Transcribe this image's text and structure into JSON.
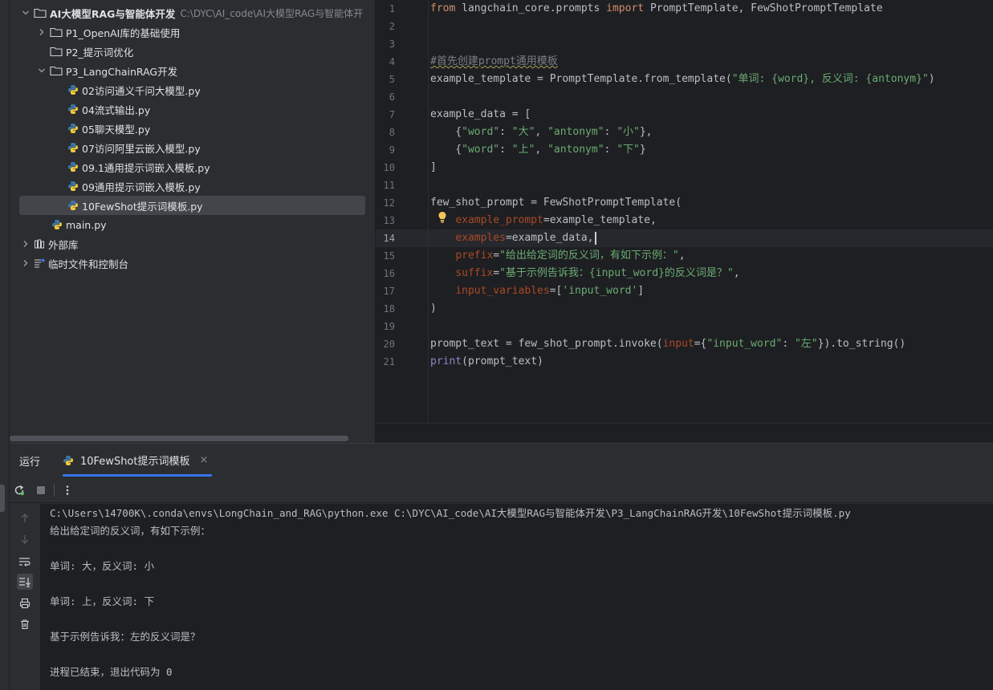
{
  "project": {
    "root_name": "AI大模型RAG与智能体开发",
    "root_path": "C:\\DYC\\AI_code\\AI大模型RAG与智能体开",
    "items": [
      {
        "label": "P1_OpenAI库的基础使用",
        "type": "folder"
      },
      {
        "label": "P2_提示词优化",
        "type": "folder"
      },
      {
        "label": "P3_LangChainRAG开发",
        "type": "folder"
      },
      {
        "label": "02访问通义千问大模型.py",
        "type": "python"
      },
      {
        "label": "04流式输出.py",
        "type": "python"
      },
      {
        "label": "05聊天模型.py",
        "type": "python"
      },
      {
        "label": "07访问阿里云嵌入模型.py",
        "type": "python"
      },
      {
        "label": "09.1通用提示词嵌入模板.py",
        "type": "python"
      },
      {
        "label": "09通用提示词嵌入模板.py",
        "type": "python"
      },
      {
        "label": "10FewShot提示词模板.py",
        "type": "python",
        "selected": true
      },
      {
        "label": "main.py",
        "type": "python"
      },
      {
        "label": "外部库",
        "type": "library"
      },
      {
        "label": "临时文件和控制台",
        "type": "scratch"
      }
    ]
  },
  "editor": {
    "current_line": 14,
    "line_numbers": [
      "1",
      "2",
      "3",
      "4",
      "5",
      "6",
      "7",
      "8",
      "9",
      "10",
      "11",
      "12",
      "13",
      "14",
      "15",
      "16",
      "17",
      "18",
      "19",
      "20",
      "21"
    ],
    "code": {
      "l1_from": "from",
      "l1_module": " langchain_core.prompts ",
      "l1_import": "import",
      "l1_names": " PromptTemplate, FewShotPromptTemplate",
      "l4_comment": "#首先创建prompt通用模板",
      "l5_a": "example_template = PromptTemplate.from_template(",
      "l5_str": "\"单词: {word}, 反义词: {antonym}\"",
      "l5_b": ")",
      "l7": "example_data = [",
      "l8_a": "    {",
      "l8_k1": "\"word\"",
      "l8_c1": ": ",
      "l8_v1": "\"大\"",
      "l8_c2": ", ",
      "l8_k2": "\"antonym\"",
      "l8_c3": ": ",
      "l8_v2": "\"小\"",
      "l8_b": "},",
      "l9_a": "    {",
      "l9_k1": "\"word\"",
      "l9_c1": ": ",
      "l9_v1": "\"上\"",
      "l9_c2": ", ",
      "l9_k2": "\"antonym\"",
      "l9_c3": ": ",
      "l9_v2": "\"下\"",
      "l9_b": "}",
      "l10": "]",
      "l12": "few_shot_prompt = FewShotPromptTemplate(",
      "l13_param": "example_prompt",
      "l13_rest": "=example_template,",
      "l14_param": "examples",
      "l14_rest": "=example_data,",
      "l15_param": "prefix",
      "l15_eq": "=",
      "l15_str": "\"给出给定词的反义词，有如下示例：\"",
      "l15_end": ",",
      "l16_param": "suffix",
      "l16_eq": "=",
      "l16_str": "\"基于示例告诉我：{input_word}的反义词是？\"",
      "l16_end": ",",
      "l17_param": "input_variables",
      "l17_eq": "=[",
      "l17_str": "'input_word'",
      "l17_end": "]",
      "l18": ")",
      "l20_a": "prompt_text = few_shot_prompt.invoke(",
      "l20_param": "input",
      "l20_b": "={",
      "l20_k": "\"input_word\"",
      "l20_c": ": ",
      "l20_v": "\"左\"",
      "l20_end": "}).to_string()",
      "l21_print": "print",
      "l21_rest": "(prompt_text)"
    }
  },
  "run": {
    "title": "运行",
    "tab_label": "10FewShot提示词模板",
    "tab_close": "×",
    "console_lines": [
      "C:\\Users\\14700K\\.conda\\envs\\LongChain_and_RAG\\python.exe C:\\DYC\\AI_code\\AI大模型RAG与智能体开发\\P3_LangChainRAG开发\\10FewShot提示词模板.py",
      "给出给定词的反义词，有如下示例：",
      "",
      "单词: 大，反义词: 小",
      "",
      "单词: 上，反义词: 下",
      "",
      "基于示例告诉我：左的反义词是？",
      "",
      "进程已结束，退出代码为 0"
    ]
  },
  "colors": {
    "keyword": "#cf8e6d",
    "string": "#6aab73",
    "comment": "#7a7e85",
    "parameter": "#aa4926",
    "accent": "#3574f0"
  }
}
